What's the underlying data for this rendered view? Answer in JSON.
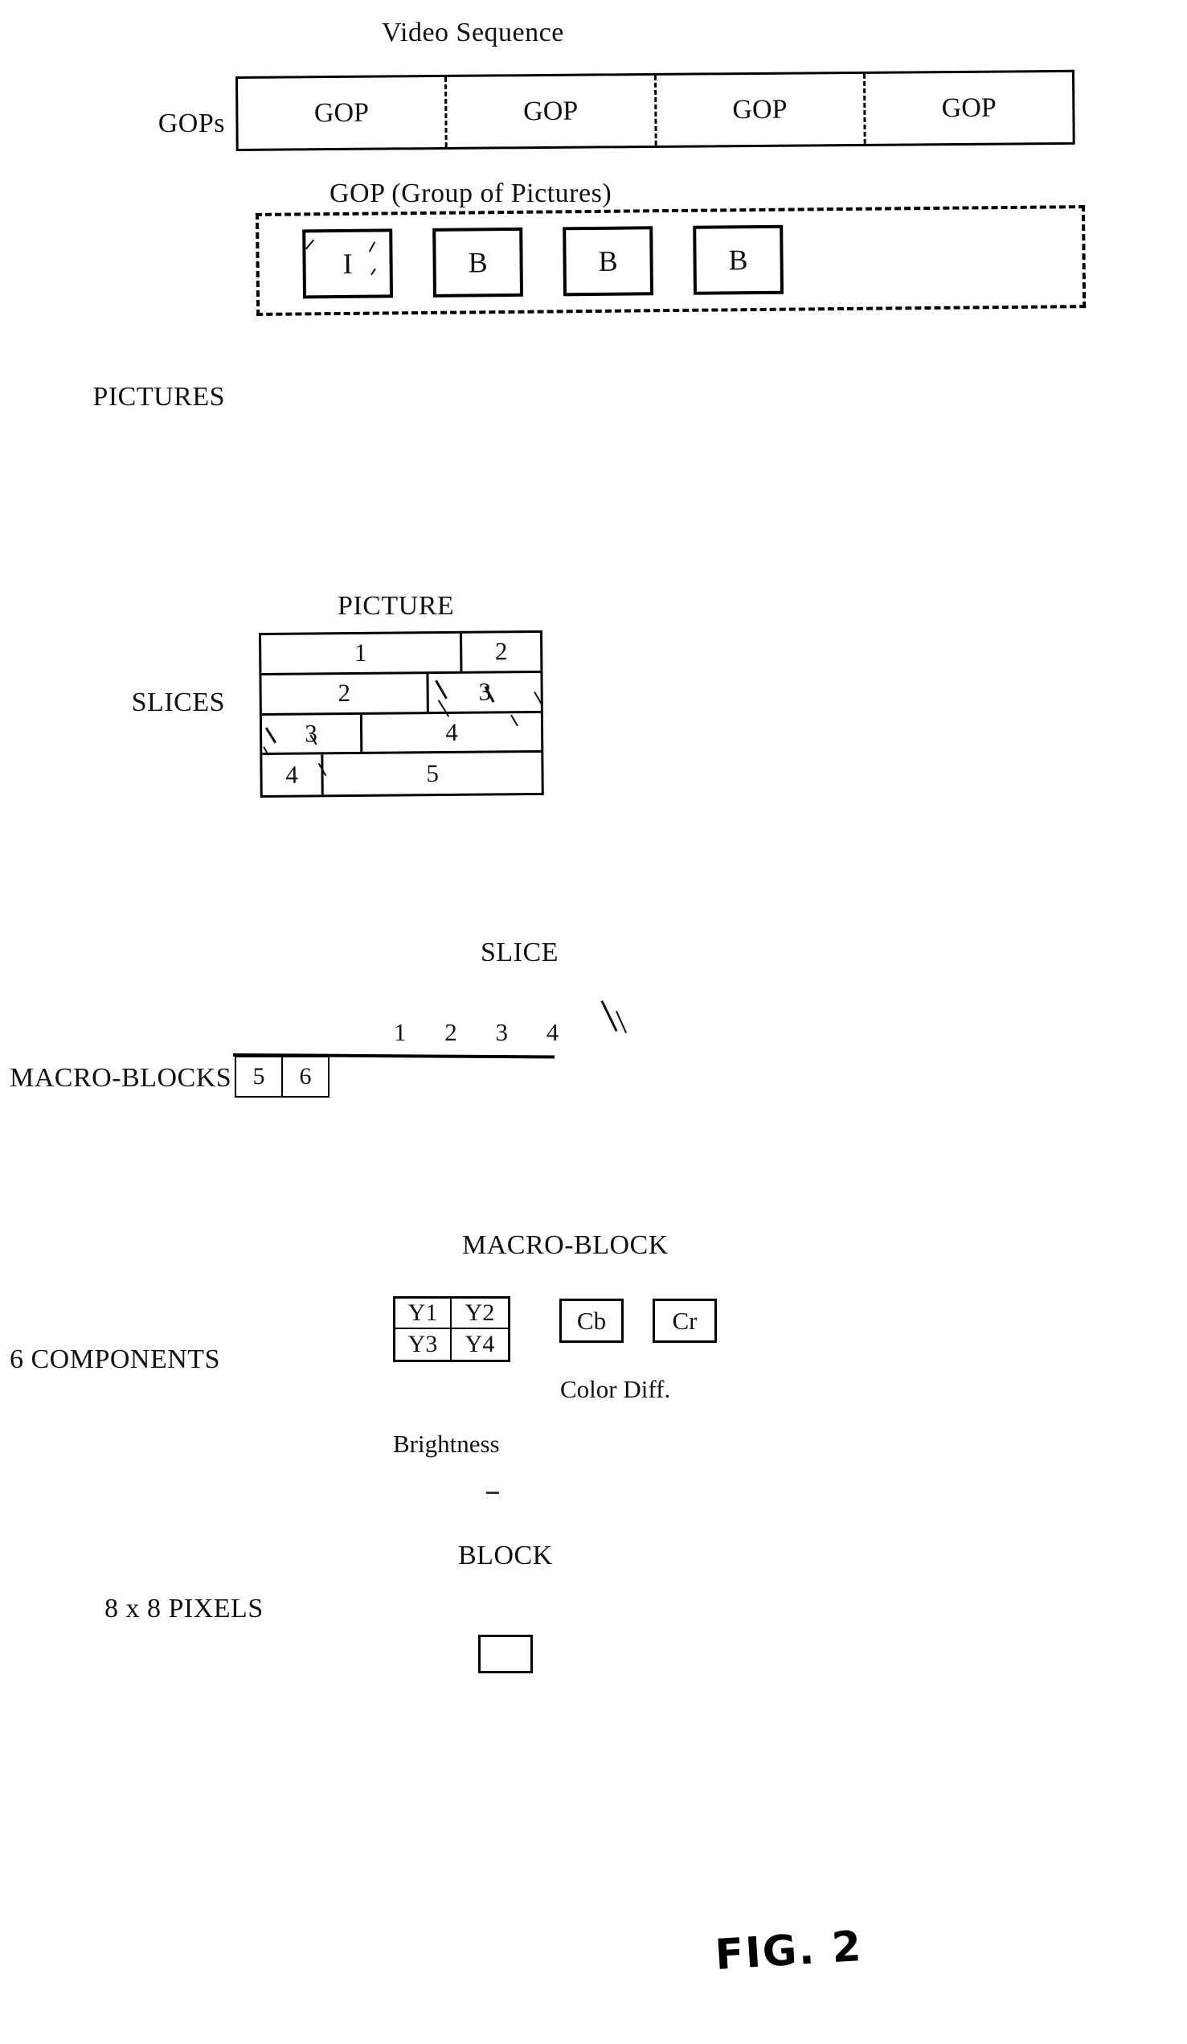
{
  "figure": {
    "caption": "FIG. 2"
  },
  "levels": {
    "video_sequence": {
      "title": "Video Sequence",
      "row_label": "GOPs",
      "cells": [
        "GOP",
        "GOP",
        "GOP",
        "GOP"
      ]
    },
    "gop": {
      "title": "GOP (Group of Pictures)",
      "row_label": "PICTURES",
      "frames": [
        "I",
        "B",
        "B",
        "B"
      ]
    },
    "picture": {
      "title": "PICTURE",
      "row_label": "SLICES",
      "rows": [
        {
          "cells": [
            {
              "label": "1",
              "width": 72
            },
            {
              "label": "2",
              "width": 28
            }
          ]
        },
        {
          "cells": [
            {
              "label": "2",
              "width": 60
            },
            {
              "label": "3",
              "width": 40
            }
          ]
        },
        {
          "cells": [
            {
              "label": "3",
              "width": 36
            },
            {
              "label": "4",
              "width": 64
            }
          ]
        },
        {
          "cells": [
            {
              "label": "4",
              "width": 22
            },
            {
              "label": "5",
              "width": 78
            }
          ]
        }
      ]
    },
    "slice": {
      "title": "SLICE",
      "row_label": "MACRO-BLOCKS",
      "leading_blocks": [
        "5",
        "6"
      ],
      "trailing_numbers": "1  2  3  4"
    },
    "macro_block": {
      "title": "MACRO-BLOCK",
      "row_label": "6 COMPONENTS",
      "luma_cells": [
        "Y1",
        "Y2",
        "Y3",
        "Y4"
      ],
      "luma_caption": "Brightness",
      "chroma_cb": "Cb",
      "chroma_cr": "Cr",
      "chroma_caption": "Color Diff."
    },
    "block": {
      "title": "BLOCK",
      "row_label": "8 x 8 PIXELS"
    }
  },
  "colors": {
    "ink": "#000000",
    "paper": "#ffffff"
  }
}
